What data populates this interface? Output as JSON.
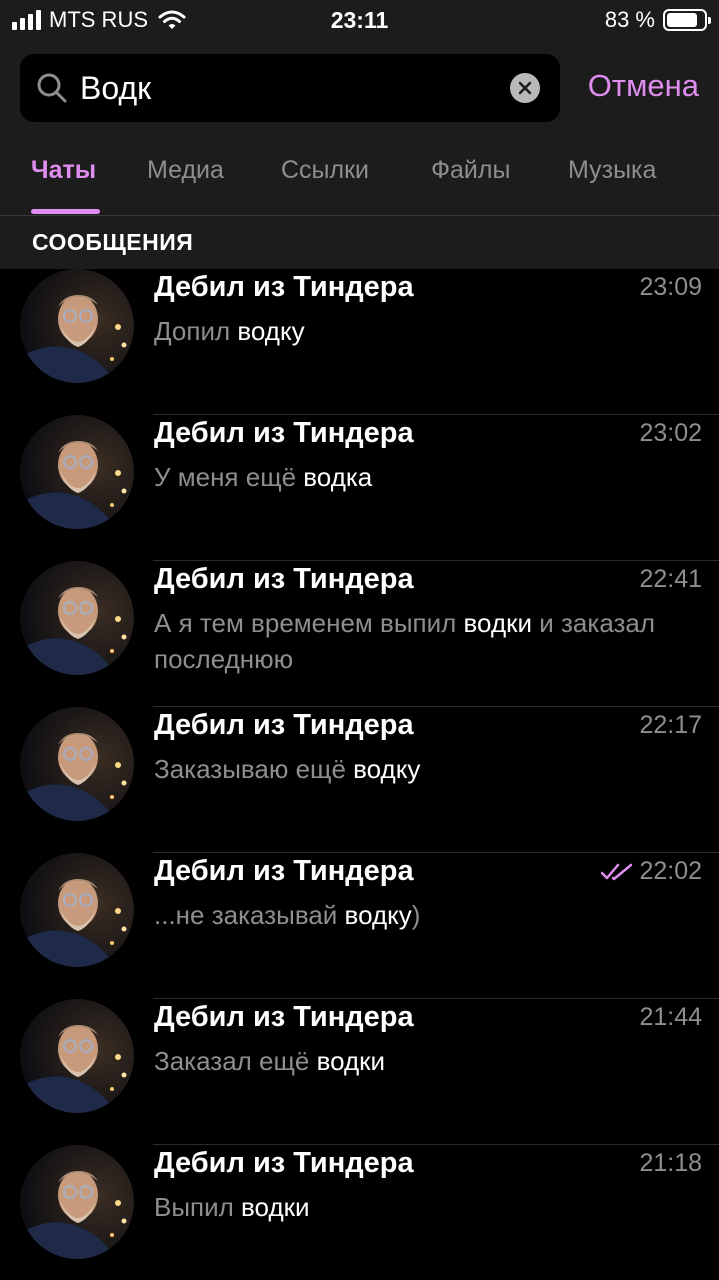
{
  "status_bar": {
    "carrier": "MTS RUS",
    "time": "23:11",
    "battery": "83 %",
    "icons": [
      "signal-icon",
      "wifi-icon",
      "battery-icon"
    ]
  },
  "search": {
    "query": "Водк",
    "cancel_label": "Отмена",
    "icons": [
      "search-icon",
      "clear-icon"
    ]
  },
  "tabs": [
    {
      "label": "Чаты",
      "active": true
    },
    {
      "label": "Медиа",
      "active": false
    },
    {
      "label": "Ссылки",
      "active": false
    },
    {
      "label": "Файлы",
      "active": false
    },
    {
      "label": "Музыка",
      "active": false
    }
  ],
  "section_title": "СООБЩЕНИЯ",
  "colors": {
    "accent": "#df8ef0",
    "background": "#000000",
    "header_bg": "#1c1c1d",
    "secondary_text": "#8e8e92"
  },
  "messages": [
    {
      "name": "Дебил из Тиндера",
      "time": "23:09",
      "pre": "Допил ",
      "match": "водку",
      "post": "",
      "read": false
    },
    {
      "name": "Дебил из Тиндера",
      "time": "23:02",
      "pre": "У меня ещё ",
      "match": "водка",
      "post": "",
      "read": false
    },
    {
      "name": "Дебил из Тиндера",
      "time": "22:41",
      "pre": "А я тем временем выпил ",
      "match": "водки",
      "post": " и заказал последнюю",
      "read": false
    },
    {
      "name": "Дебил из Тиндера",
      "time": "22:17",
      "pre": "Заказываю ещё ",
      "match": "водку",
      "post": "",
      "read": false
    },
    {
      "name": "Дебил из Тиндера",
      "time": "22:02",
      "pre": "...не заказывай ",
      "match": "водку",
      "post": ")",
      "read": true
    },
    {
      "name": "Дебил из Тиндера",
      "time": "21:44",
      "pre": "Заказал ещё ",
      "match": "водки",
      "post": "",
      "read": false
    },
    {
      "name": "Дебил из Тиндера",
      "time": "21:18",
      "pre": "Выпил ",
      "match": "водки",
      "post": "",
      "read": false
    }
  ]
}
